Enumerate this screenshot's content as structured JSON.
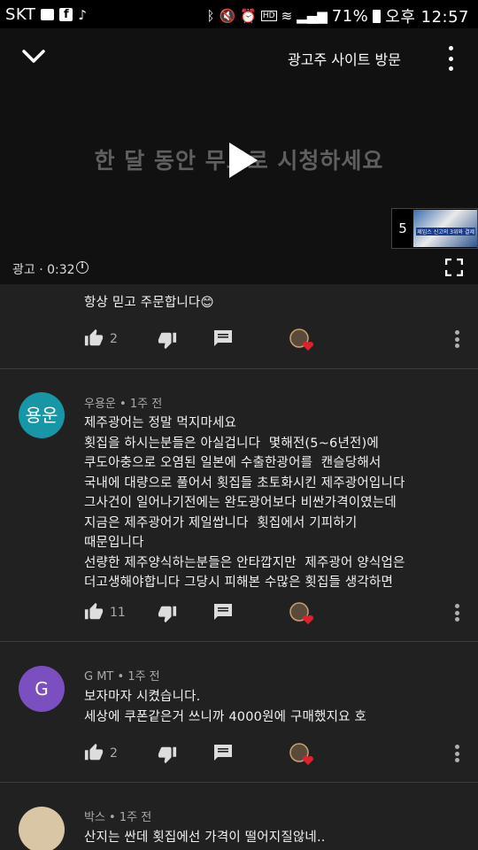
{
  "status_bar": {
    "carrier": "SKT",
    "battery": "71%",
    "time": "오후 12:57",
    "icons": [
      "message-icon",
      "facebook-icon",
      "tiktok-icon",
      "bluetooth-icon",
      "mute-icon",
      "alarm-icon",
      "volte-icon",
      "wifi-icon",
      "signal-icon",
      "battery-icon"
    ]
  },
  "player": {
    "visit_site": "광고주 사이트 방문",
    "headline": "한 달 동안 무료로 시청하세요",
    "skip_countdown": "5",
    "ad_timer": "광고 · 0:32",
    "thumbnail_caption": "제임스 신고의\n3위와 결제"
  },
  "comments": [
    {
      "text": "항상 믿고 주문합니다😊",
      "likes": "2",
      "partial": true
    },
    {
      "author": "우용운",
      "time": "1주 전",
      "avatar_text": "용운",
      "avatar_color": "#1796a6",
      "text": "제주광어는 정말 먹지마세요\n횟집을 하시는분들은 아실겁니다  몇해전(5~6년전)에\n쿠도아충으로 오염된 일본에 수출한광어를  캔슬당해서\n국내에 대량으로 풀어서 횟집들 초토화시킨 제주광어입니다\n그사건이 일어나기전에는 완도광어보다 비싼가격이였는데\n지금은 제주광어가 제일쌉니다  횟집에서 기피하기\n때문입니다\n선량한 제주양식하는분들은 안타깝지만  제주광어 양식업은\n더고생해야합니다 그당시 피해본 수많은 횟집들 생각하면",
      "likes": "11"
    },
    {
      "author": "G MT",
      "time": "1주 전",
      "avatar_text": "G",
      "avatar_color": "#7b4fbf",
      "text": "보자마자 시켰습니다.\n세상에 쿠폰같은거 쓰니까 4000원에 구매했지요 호",
      "likes": "2"
    },
    {
      "author": "박스",
      "time": "1주 전",
      "avatar_text": "",
      "avatar_color": "#d9c6a5",
      "text": "산지는 싼데 횟집에선 가격이 떨어지질않네..",
      "likes": ""
    }
  ],
  "colors": {
    "background": "#212121",
    "divider": "#3c3c3c",
    "heart": "#e0202a"
  }
}
